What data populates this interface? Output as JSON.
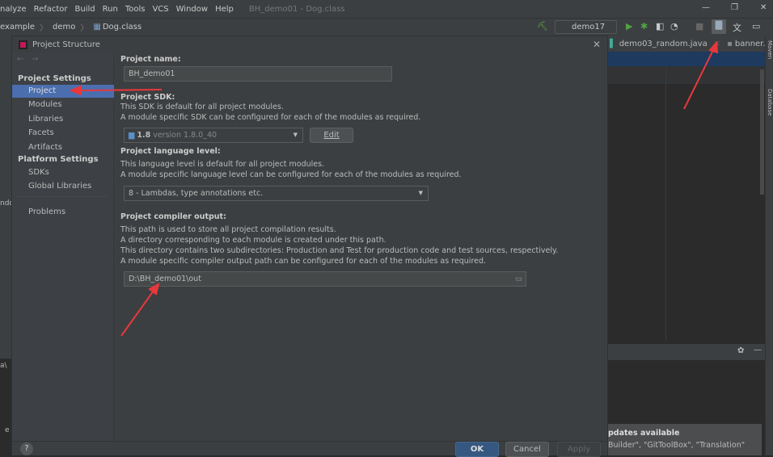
{
  "menubar": {
    "items": [
      "nalyze",
      "Refactor",
      "Build",
      "Run",
      "Tools",
      "VCS",
      "Window",
      "Help"
    ],
    "title": "BH_demo01 - Dog.class"
  },
  "navbar": {
    "crumbs": [
      "example",
      "demo",
      "Dog.class"
    ],
    "run_config": "demo17"
  },
  "editor": {
    "tabs": [
      "demo03_random.java",
      "banner."
    ],
    "side_panels": [
      "Maven",
      "Database"
    ]
  },
  "left_ide": {
    "fragments": [
      "ndc",
      "a\\",
      "e"
    ]
  },
  "notification": {
    "title": "pdates available",
    "body": "Builder\", \"GitToolBox\", \"Translation\""
  },
  "dialog": {
    "title": "Project Structure",
    "sidebar": {
      "project_settings": "Project Settings",
      "items": [
        "Project",
        "Modules",
        "Libraries",
        "Facets",
        "Artifacts"
      ],
      "platform_settings": "Platform Settings",
      "platform_items": [
        "SDKs",
        "Global Libraries"
      ],
      "problems": "Problems"
    },
    "name_label": "Project name:",
    "name_value": "BH_demo01",
    "sdk_label": "Project SDK:",
    "sdk_desc1": "This SDK is default for all project modules.",
    "sdk_desc2": "A module specific SDK can be configured for each of the modules as required.",
    "sdk_value": "1.8",
    "sdk_version": "version 1.8.0_40",
    "edit": "Edit",
    "lang_label": "Project language level:",
    "lang_desc1": "This language level is default for all project modules.",
    "lang_desc2": "A module specific language level can be configured for each of the modules as required.",
    "lang_value": "8 - Lambdas, type annotations etc.",
    "out_label": "Project compiler output:",
    "out_desc1": "This path is used to store all project compilation results.",
    "out_desc2": "A directory corresponding to each module is created under this path.",
    "out_desc3": "This directory contains two subdirectories: Production and Test for production code and test sources, respectively.",
    "out_desc4": "A module specific compiler output path can be configured for each of the modules as required.",
    "out_value": "D:\\BH_demo01\\out",
    "ok": "OK",
    "cancel": "Cancel",
    "apply": "Apply",
    "help": "?"
  },
  "colors": {
    "selection": "#4b6eaf",
    "annotation_arrow": "#e8383d",
    "ok_button": "#365880"
  }
}
